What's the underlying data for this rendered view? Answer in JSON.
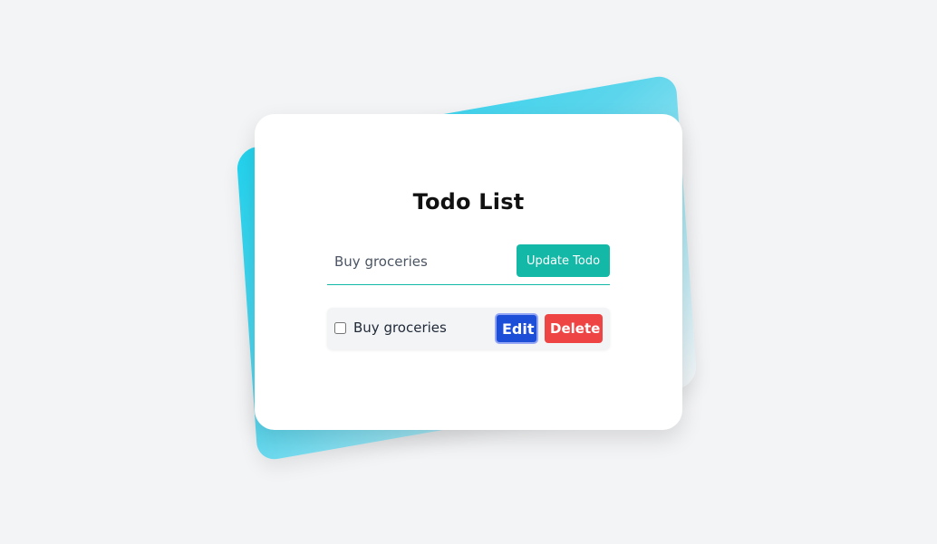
{
  "app": {
    "title": "Todo List"
  },
  "form": {
    "input_value": "Buy groceries",
    "submit_label": "Update Todo"
  },
  "todos": [
    {
      "text": "Buy groceries",
      "completed": false,
      "edit_label": "Edit",
      "delete_label": "Delete"
    }
  ],
  "colors": {
    "background": "#f3f4f6",
    "accent": "#14b8a6",
    "edit": "#1d4ed8",
    "delete": "#ef4444",
    "gradient_start": "#22d3ee"
  }
}
